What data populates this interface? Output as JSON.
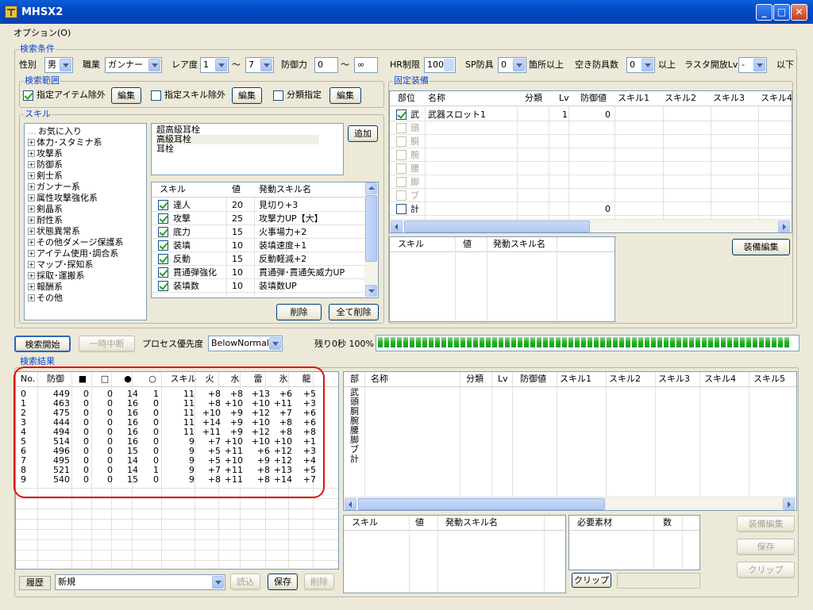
{
  "window": {
    "title": "MHSX2"
  },
  "menu": {
    "options": "オプション(O)"
  },
  "search_conditions": {
    "label": "検索条件",
    "gender_label": "性別",
    "gender_value": "男",
    "job_label": "職業",
    "job_value": "ガンナー",
    "rarity_label": "レア度",
    "rarity_min": "1",
    "tilde": "～",
    "rarity_max": "7",
    "defense_label": "防御力",
    "defense_min": "0",
    "defense_max": "∞",
    "hr_label": "HR制限",
    "hr_value": "100",
    "sp_label": "SP防具",
    "sp_value": "0",
    "sp_suffix": "箇所以上",
    "slots_label": "空き防具数",
    "slots_value": "0",
    "slots_suffix": "以上",
    "last_label": "ラスタ開放Lv",
    "last_value": "-",
    "last_suffix": "以下"
  },
  "search_range": {
    "label": "検索範囲",
    "exclude_items": "指定アイテム除外",
    "edit1": "編集",
    "exclude_skills": "指定スキル除外",
    "edit2": "編集",
    "category": "分類指定",
    "edit3": "編集"
  },
  "skills": {
    "label": "スキル",
    "tree": [
      "お気に入り",
      "体力･スタミナ系",
      "攻撃系",
      "防御系",
      "剣士系",
      "ガンナー系",
      "属性攻撃強化系",
      "剣晶系",
      "耐性系",
      "状態異常系",
      "その他ダメージ保護系",
      "アイテム使用･調合系",
      "マップ･探知系",
      "採取･運搬系",
      "報酬系",
      "その他"
    ],
    "picked": [
      "超高級耳栓",
      "高級耳栓",
      "耳栓"
    ],
    "add_button": "追加",
    "headers": {
      "skill": "スキル",
      "value": "値",
      "active": "発動スキル名"
    },
    "rows": [
      {
        "skill": "達人",
        "value": "20",
        "active": "見切り+3"
      },
      {
        "skill": "攻撃",
        "value": "25",
        "active": "攻撃力UP【大】"
      },
      {
        "skill": "底力",
        "value": "15",
        "active": "火事場力+2"
      },
      {
        "skill": "装填",
        "value": "10",
        "active": "装填速度+1"
      },
      {
        "skill": "反動",
        "value": "15",
        "active": "反動軽減+2"
      },
      {
        "skill": "貫通弾強化",
        "value": "10",
        "active": "貫通弾･貫通矢威力UP"
      },
      {
        "skill": "装填数",
        "value": "10",
        "active": "装填数UP"
      }
    ],
    "delete_button": "削除",
    "delete_all_button": "全て削除"
  },
  "fixed_equip": {
    "label": "固定装備",
    "headers": [
      "部位",
      "名称",
      "分類",
      "Lv",
      "防御値",
      "スキル1",
      "スキル2",
      "スキル3",
      "スキル4"
    ],
    "rows": [
      {
        "part": "武",
        "name": "武器スロット1",
        "lv": "1",
        "def": "0",
        "checked": true,
        "dim": false
      },
      {
        "part": "頭",
        "name": "",
        "lv": "",
        "def": "",
        "checked": false,
        "dim": true
      },
      {
        "part": "胴",
        "name": "",
        "lv": "",
        "def": "",
        "checked": false,
        "dim": true
      },
      {
        "part": "腕",
        "name": "",
        "lv": "",
        "def": "",
        "checked": false,
        "dim": true
      },
      {
        "part": "腰",
        "name": "",
        "lv": "",
        "def": "",
        "checked": false,
        "dim": true
      },
      {
        "part": "脚",
        "name": "",
        "lv": "",
        "def": "",
        "checked": false,
        "dim": true
      },
      {
        "part": "ブ",
        "name": "",
        "lv": "",
        "def": "",
        "checked": false,
        "dim": true
      },
      {
        "part": "計",
        "name": "",
        "lv": "",
        "def": "0",
        "checked": false,
        "dim": false
      }
    ],
    "skill_headers": {
      "skill": "スキル",
      "value": "値",
      "active": "発動スキル名"
    },
    "edit_button": "装備編集"
  },
  "controls": {
    "start": "検索開始",
    "pause": "一時中断",
    "priority_label": "プロセス優先度",
    "priority_value": "BelowNormal",
    "remaining": "残り0秒 100%",
    "progress": 1.0
  },
  "results": {
    "label": "検索結果",
    "headers": [
      "No.",
      "防御",
      "■",
      "□",
      "●",
      "○",
      "スキル",
      "火",
      "水",
      "雷",
      "氷",
      "龍"
    ],
    "rows": [
      [
        "0",
        "449",
        "0",
        "0",
        "14",
        "1",
        "11",
        "+8",
        "+8",
        "+13",
        "+6",
        "+5"
      ],
      [
        "1",
        "463",
        "0",
        "0",
        "16",
        "0",
        "11",
        "+8",
        "+10",
        "+10",
        "+11",
        "+3"
      ],
      [
        "2",
        "475",
        "0",
        "0",
        "16",
        "0",
        "11",
        "+10",
        "+9",
        "+12",
        "+7",
        "+6"
      ],
      [
        "3",
        "444",
        "0",
        "0",
        "16",
        "0",
        "11",
        "+14",
        "+9",
        "+10",
        "+8",
        "+6"
      ],
      [
        "4",
        "494",
        "0",
        "0",
        "16",
        "0",
        "11",
        "+11",
        "+9",
        "+12",
        "+8",
        "+8"
      ],
      [
        "5",
        "514",
        "0",
        "0",
        "16",
        "0",
        "9",
        "+7",
        "+10",
        "+10",
        "+10",
        "+1"
      ],
      [
        "6",
        "496",
        "0",
        "0",
        "15",
        "0",
        "9",
        "+5",
        "+11",
        "+6",
        "+12",
        "+3"
      ],
      [
        "7",
        "495",
        "0",
        "0",
        "14",
        "0",
        "9",
        "+5",
        "+10",
        "+9",
        "+12",
        "+4"
      ],
      [
        "8",
        "521",
        "0",
        "0",
        "14",
        "1",
        "9",
        "+7",
        "+11",
        "+8",
        "+13",
        "+5"
      ],
      [
        "9",
        "540",
        "0",
        "0",
        "15",
        "0",
        "9",
        "+8",
        "+11",
        "+8",
        "+14",
        "+7"
      ]
    ],
    "history_label": "履歴",
    "history_value": "新規",
    "load": "読込",
    "save": "保存",
    "delete": "削除"
  },
  "detail": {
    "headers": [
      "部",
      "名称",
      "分類",
      "Lv",
      "防御値",
      "スキル1",
      "スキル2",
      "スキル3",
      "スキル4",
      "スキル5"
    ],
    "parts": [
      "武",
      "頭",
      "胴",
      "腕",
      "腰",
      "脚",
      "ブ",
      "計"
    ],
    "skill_headers": {
      "skill": "スキル",
      "value": "値",
      "active": "発動スキル名"
    },
    "material_headers": {
      "material": "必要素材",
      "count": "数"
    },
    "clip_button": "クリップ",
    "edit_button": "装備編集",
    "save_button": "保存",
    "clip_button2": "クリップ"
  },
  "colors": {
    "accent": "#0a46d4",
    "highlight": "#e01212",
    "progress": "#22b022"
  }
}
